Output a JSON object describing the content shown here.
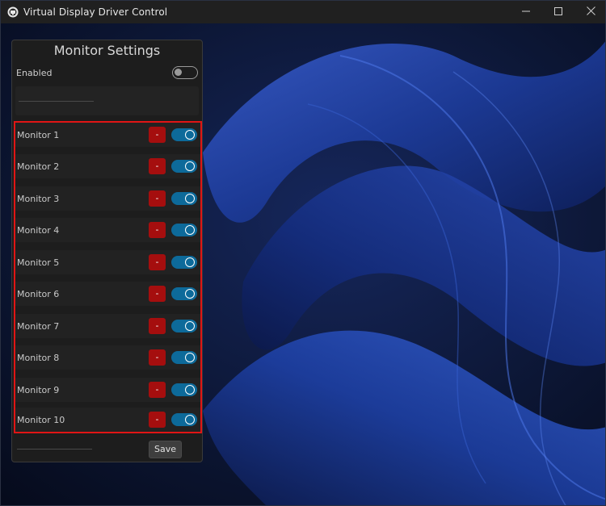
{
  "window": {
    "title": "Virtual Display Driver Control",
    "controls": [
      "minimize-icon",
      "maximize-icon",
      "close-icon"
    ]
  },
  "panel": {
    "title": "Monitor Settings",
    "enabled_label": "Enabled",
    "enabled_state": false,
    "name_input_value": "",
    "monitors": [
      {
        "label": "Monitor 1",
        "remove_label": "-",
        "enabled": true
      },
      {
        "label": "Monitor 2",
        "remove_label": "-",
        "enabled": true
      },
      {
        "label": "Monitor 3",
        "remove_label": "-",
        "enabled": true
      },
      {
        "label": "Monitor 4",
        "remove_label": "-",
        "enabled": true
      },
      {
        "label": "Monitor 5",
        "remove_label": "-",
        "enabled": true
      },
      {
        "label": "Monitor 6",
        "remove_label": "-",
        "enabled": true
      },
      {
        "label": "Monitor 7",
        "remove_label": "-",
        "enabled": true
      },
      {
        "label": "Monitor 8",
        "remove_label": "-",
        "enabled": true
      },
      {
        "label": "Monitor 9",
        "remove_label": "-",
        "enabled": true
      },
      {
        "label": "Monitor 10",
        "remove_label": "-",
        "enabled": true
      }
    ],
    "footer_input_value": "",
    "save_label": "Save"
  },
  "colors": {
    "accent_toggle": "#0d6a9a",
    "remove_button": "#a50e0e",
    "highlight_border": "#e01515",
    "panel_background": "#1d1d1d"
  }
}
